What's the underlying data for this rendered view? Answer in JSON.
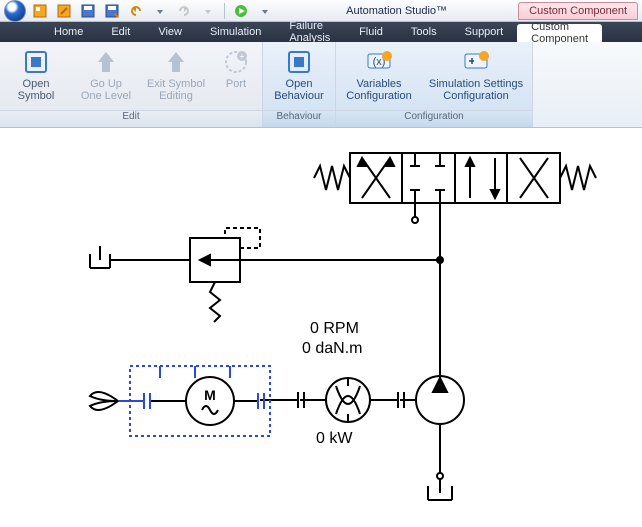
{
  "app_title": "Automation Studio™",
  "title_tab": "Custom Component",
  "menu": {
    "items": [
      "Home",
      "Edit",
      "View",
      "Simulation",
      "Failure Analysis",
      "Fluid",
      "Tools",
      "Support",
      "Custom Component"
    ],
    "active_index": 8
  },
  "ribbon": {
    "groups": [
      {
        "title": "Edit",
        "active": false,
        "buttons": [
          {
            "label_l1": "Open",
            "label_l2": "Symbol",
            "icon": "open-symbol",
            "enabled": true
          },
          {
            "label_l1": "Go Up",
            "label_l2": "One Level",
            "icon": "go-up",
            "enabled": false
          },
          {
            "label_l1": "Exit Symbol",
            "label_l2": "Editing",
            "icon": "exit-symbol",
            "enabled": false
          },
          {
            "label_l1": "Port",
            "label_l2": "",
            "icon": "port",
            "enabled": false
          }
        ]
      },
      {
        "title": "Behaviour",
        "active": true,
        "buttons": [
          {
            "label_l1": "Open",
            "label_l2": "Behaviour",
            "icon": "open-behaviour",
            "enabled": true
          }
        ]
      },
      {
        "title": "Configuration",
        "active": true,
        "buttons": [
          {
            "label_l1": "Variables",
            "label_l2": "Configuration",
            "icon": "variables",
            "enabled": true
          },
          {
            "label_l1": "Simulation Settings",
            "label_l2": "Configuration",
            "icon": "sim-settings",
            "enabled": true
          }
        ]
      }
    ]
  },
  "canvas": {
    "readings": {
      "rpm": "0 RPM",
      "torque": "0 daN.m",
      "power": "0 kW"
    },
    "motor_label": "M"
  }
}
